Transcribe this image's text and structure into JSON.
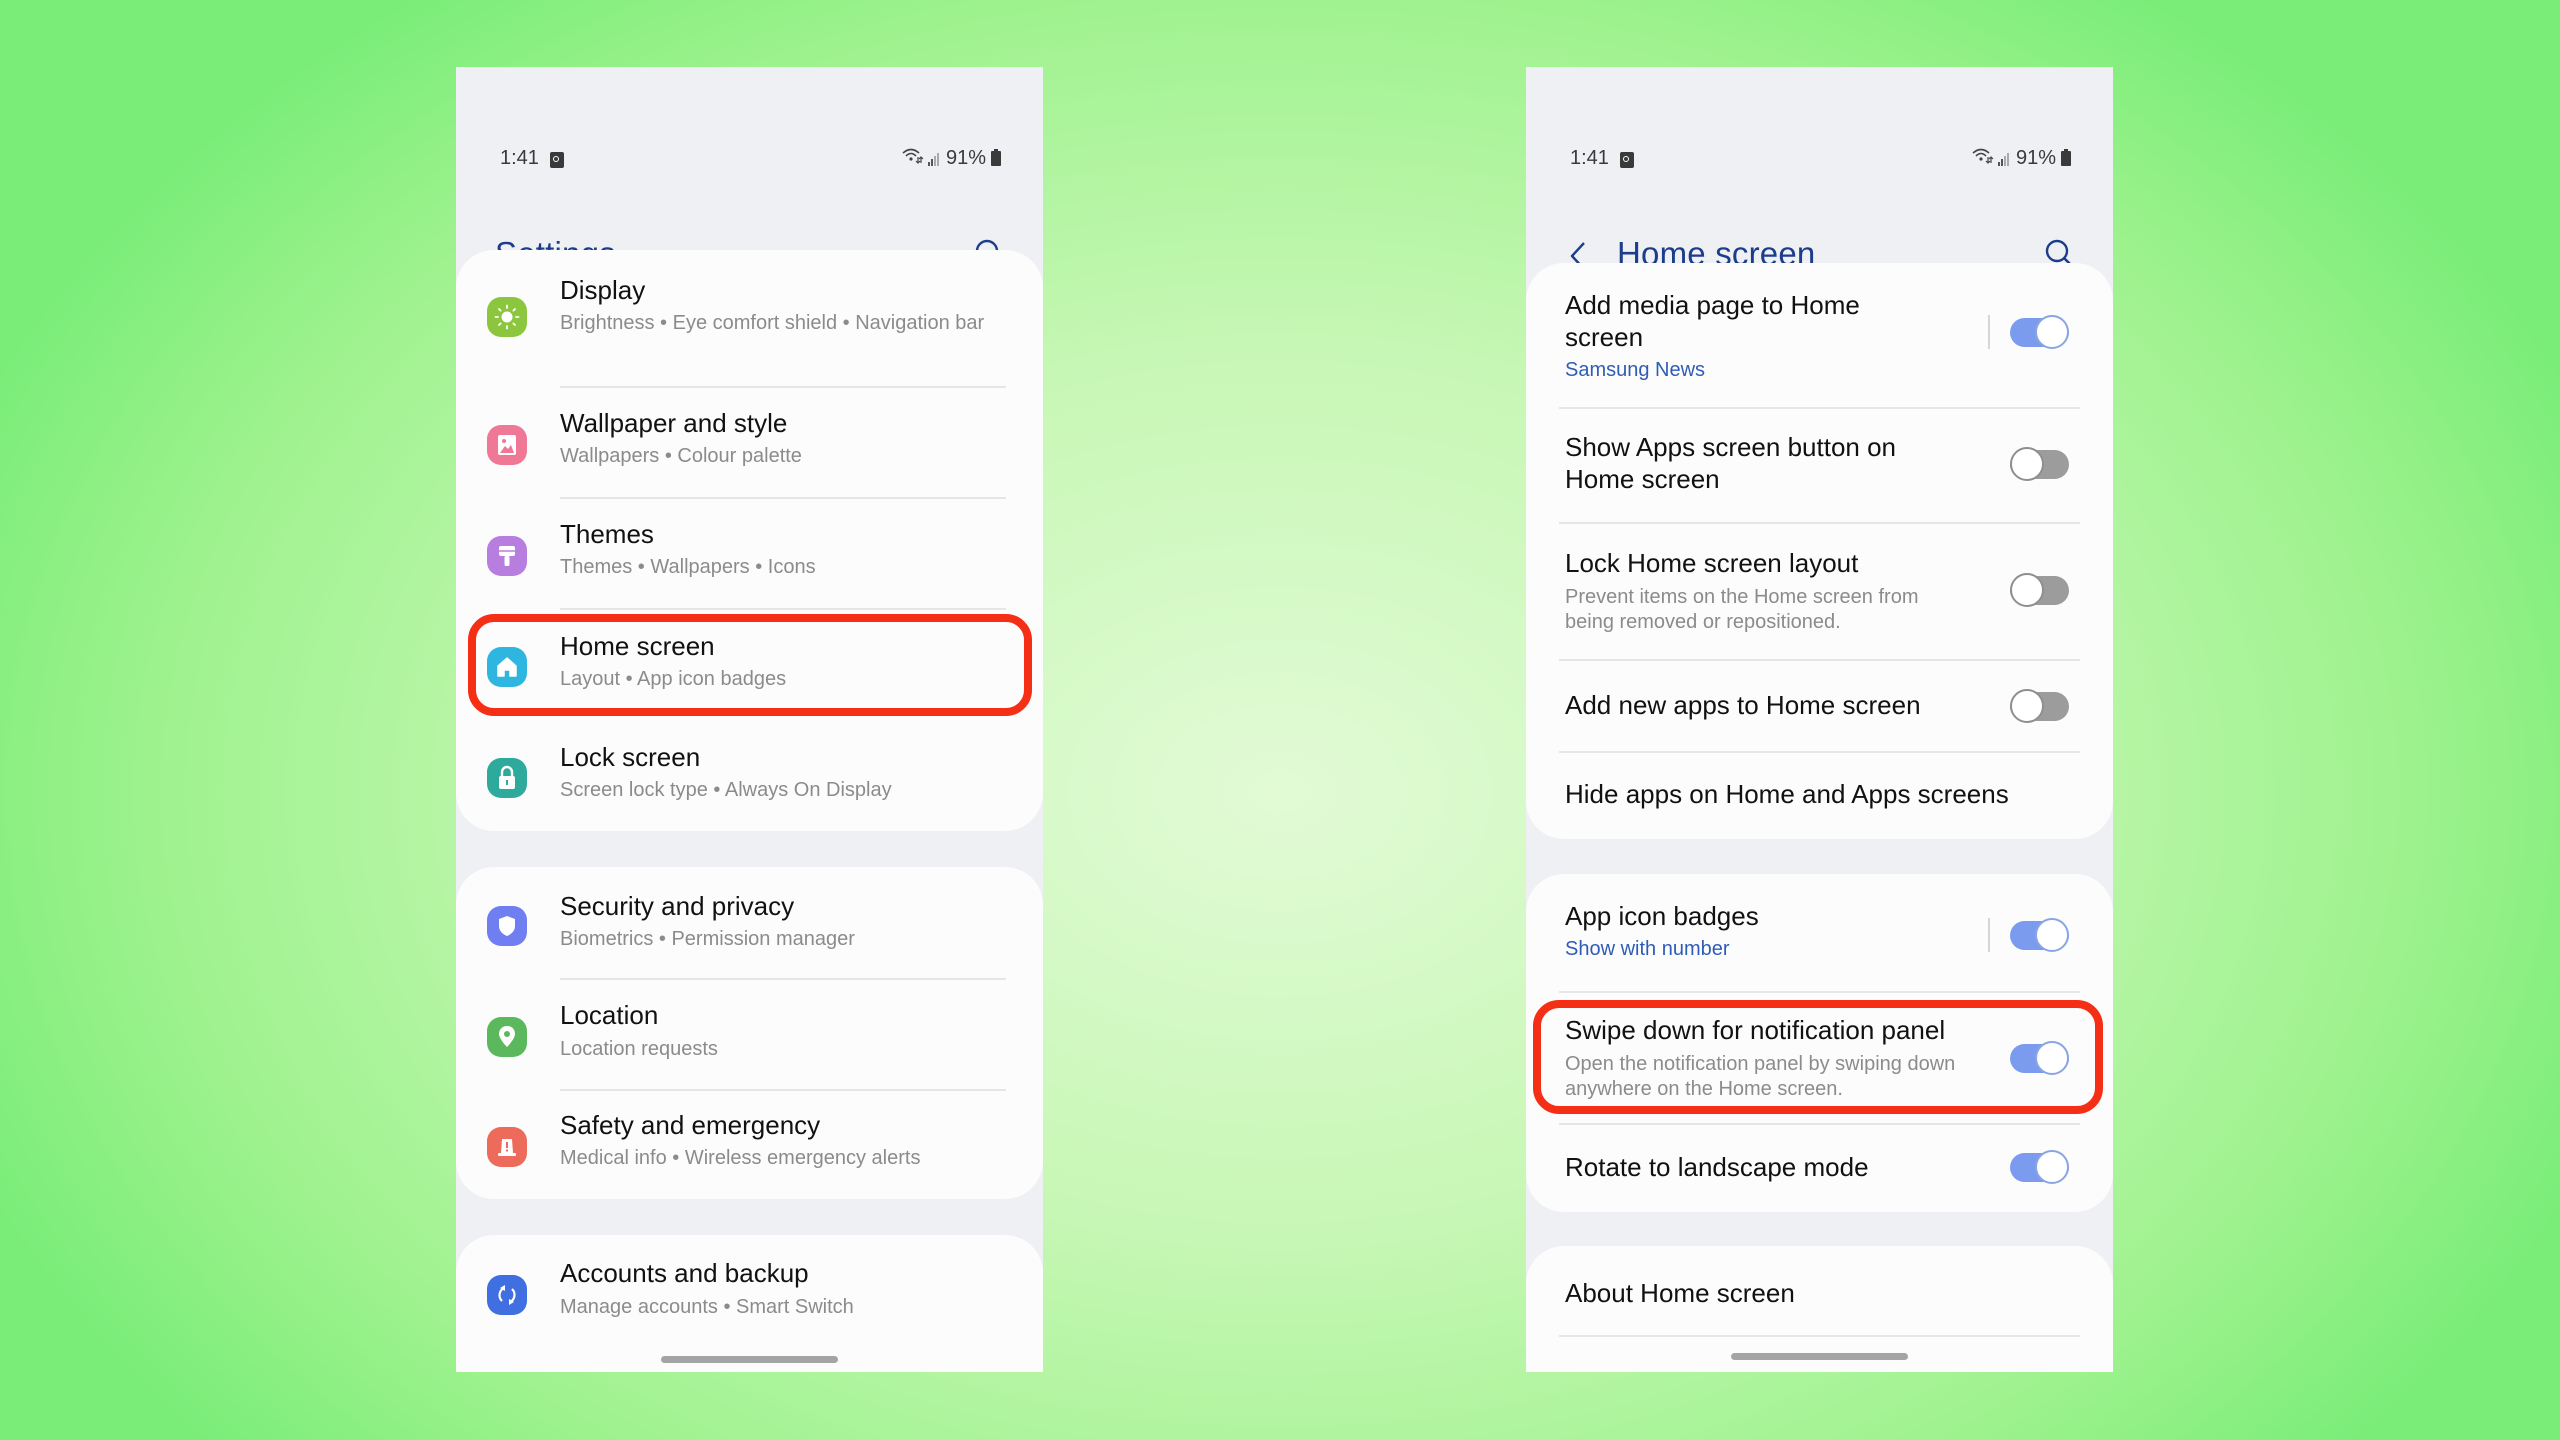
{
  "status_bar": {
    "time": "1:41",
    "battery": "91%",
    "icons": [
      "alarm-icon",
      "wifi-icon",
      "signal-icon",
      "battery-icon"
    ]
  },
  "left_screen": {
    "title": "Settings",
    "search_icon": "search-icon",
    "groups": [
      {
        "items": [
          {
            "title": "Display",
            "subtitle": "Brightness  •  Eye comfort shield  •  Navigation bar",
            "icon": "sun-icon",
            "color": "#8cc63f"
          },
          {
            "title": "Wallpaper and style",
            "subtitle": "Wallpapers  •  Colour palette",
            "icon": "image-icon",
            "color": "#ee7895"
          },
          {
            "title": "Themes",
            "subtitle": "Themes  •  Wallpapers  •  Icons",
            "icon": "brush-icon",
            "color": "#b77ee0"
          },
          {
            "title": "Home screen",
            "subtitle": "Layout  •  App icon badges",
            "icon": "home-icon",
            "color": "#2eb6e0",
            "highlighted": true
          },
          {
            "title": "Lock screen",
            "subtitle": "Screen lock type  •  Always On Display",
            "icon": "lock-icon",
            "color": "#2eaa9c"
          }
        ]
      },
      {
        "items": [
          {
            "title": "Security and privacy",
            "subtitle": "Biometrics  •  Permission manager",
            "icon": "shield-icon",
            "color": "#6f7ef0"
          },
          {
            "title": "Location",
            "subtitle": "Location requests",
            "icon": "location-pin-icon",
            "color": "#5cb85c"
          },
          {
            "title": "Safety and emergency",
            "subtitle": "Medical info  •  Wireless emergency alerts",
            "icon": "alert-icon",
            "color": "#ec6b5b"
          }
        ]
      },
      {
        "items": [
          {
            "title": "Accounts and backup",
            "subtitle": "Manage accounts  •  Smart Switch",
            "icon": "sync-icon",
            "color": "#3f6fe0"
          }
        ]
      }
    ]
  },
  "right_screen": {
    "title": "Home screen",
    "back_icon": "chevron-left-icon",
    "search_icon": "search-icon",
    "groups": [
      {
        "items": [
          {
            "title": "Add media page to Home screen",
            "summary": "Samsung News",
            "toggle": true
          },
          {
            "title": "Show Apps screen button on Home screen",
            "toggle": false
          },
          {
            "title": "Lock Home screen layout",
            "subtitle": "Prevent items on the Home screen from being removed or repositioned.",
            "toggle": false
          },
          {
            "title": "Add new apps to Home screen",
            "toggle": false
          },
          {
            "title": "Hide apps on Home and Apps screens"
          }
        ]
      },
      {
        "items": [
          {
            "title": "App icon badges",
            "summary": "Show with number",
            "toggle": true
          },
          {
            "title": "Swipe down for notification panel",
            "subtitle": "Open the notification panel by swiping down anywhere on the Home screen.",
            "toggle": true,
            "highlighted": true
          },
          {
            "title": "Rotate to landscape mode",
            "toggle": true
          }
        ]
      },
      {
        "items": [
          {
            "title": "About Home screen"
          }
        ]
      }
    ]
  },
  "colors": {
    "title_blue": "#1c3c8c",
    "summary_blue": "#2f5cb8",
    "toggle_on": "#7b9cee",
    "toggle_off": "#9c9c9c",
    "highlight_red": "#f52f15",
    "background_green": "#9ef28e"
  }
}
